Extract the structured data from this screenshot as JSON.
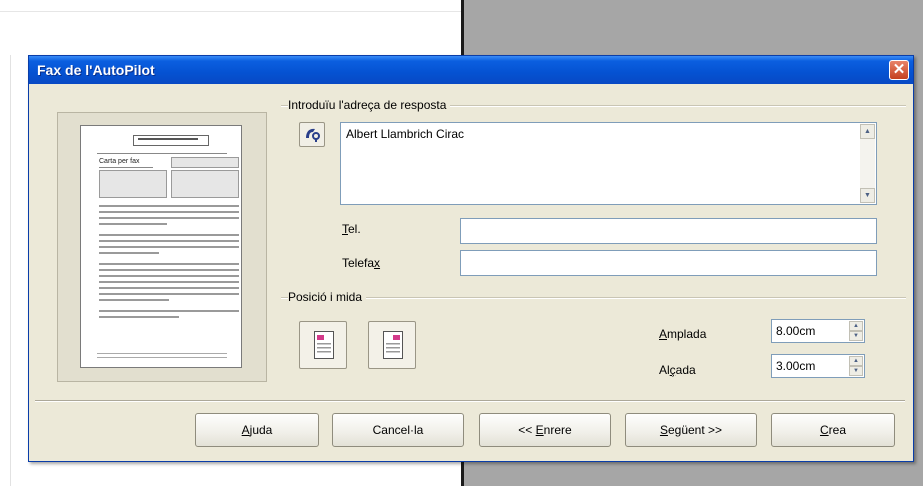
{
  "window": {
    "title": "Fax de l'AutoPilot"
  },
  "preview": {
    "page_heading_text": "Carta per fax"
  },
  "reply_address": {
    "group_label": "Introduïu l'adreça de resposta",
    "address_text": "Albert Llambrich Cirac",
    "phone_label": "Tel.",
    "phone_value": "",
    "fax_label": "Telefax",
    "fax_value": ""
  },
  "position_size": {
    "group_label": "Posició i mida",
    "width_label": "Amplada",
    "width_value": "8.00cm",
    "height_label": "Alçada",
    "height_value": "3.00cm"
  },
  "buttons": {
    "help": "Ajuda",
    "cancel": "Cancel·la",
    "back": "<< Enrere",
    "next": "Següent >>",
    "create": "Crea"
  },
  "colors": {
    "titlebar": "#0552d2",
    "dialog_bg": "#ece9d8",
    "close_button": "#c4401f"
  }
}
